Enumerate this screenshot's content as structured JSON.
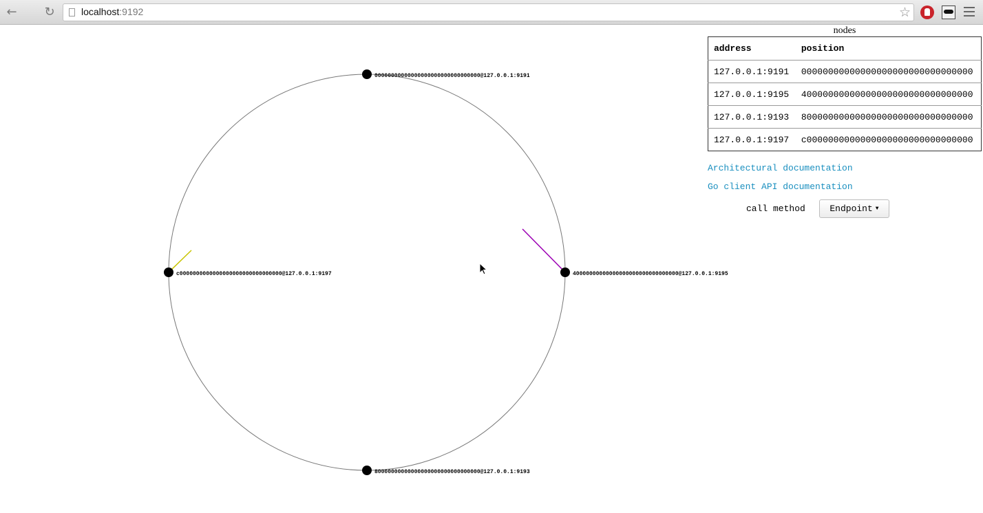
{
  "browser": {
    "url_host": "localhost",
    "url_port": ":9192",
    "nav_back": "←",
    "nav_reload": "↻",
    "bookmark_star": "☆"
  },
  "ring": {
    "nodes": [
      {
        "label": "00000000000000000000000000000000@127.0.0.1:9191",
        "angle_deg": 0
      },
      {
        "label": "40000000000000000000000000000000@127.0.0.1:9195",
        "angle_deg": 90
      },
      {
        "label": "80000000000000000000000000000000@127.0.0.1:9193",
        "angle_deg": 180
      },
      {
        "label": "c0000000000000000000000000000000@127.0.0.1:9197",
        "angle_deg": 270
      }
    ],
    "colors": {
      "circle": "#777777",
      "node": "#000000",
      "line_purple": "#9c00b3",
      "line_yellow": "#c8c400"
    }
  },
  "panel": {
    "caption": "nodes",
    "table": {
      "headers": [
        "address",
        "position"
      ],
      "rows": [
        [
          "127.0.0.1:9191",
          "00000000000000000000000000000000"
        ],
        [
          "127.0.0.1:9195",
          "40000000000000000000000000000000"
        ],
        [
          "127.0.0.1:9193",
          "80000000000000000000000000000000"
        ],
        [
          "127.0.0.1:9197",
          "c0000000000000000000000000000000"
        ]
      ]
    },
    "links": {
      "architectural": "Architectural documentation",
      "go_client": "Go client API documentation"
    },
    "call_method_label": "call method",
    "call_method_value": "Endpoint"
  }
}
